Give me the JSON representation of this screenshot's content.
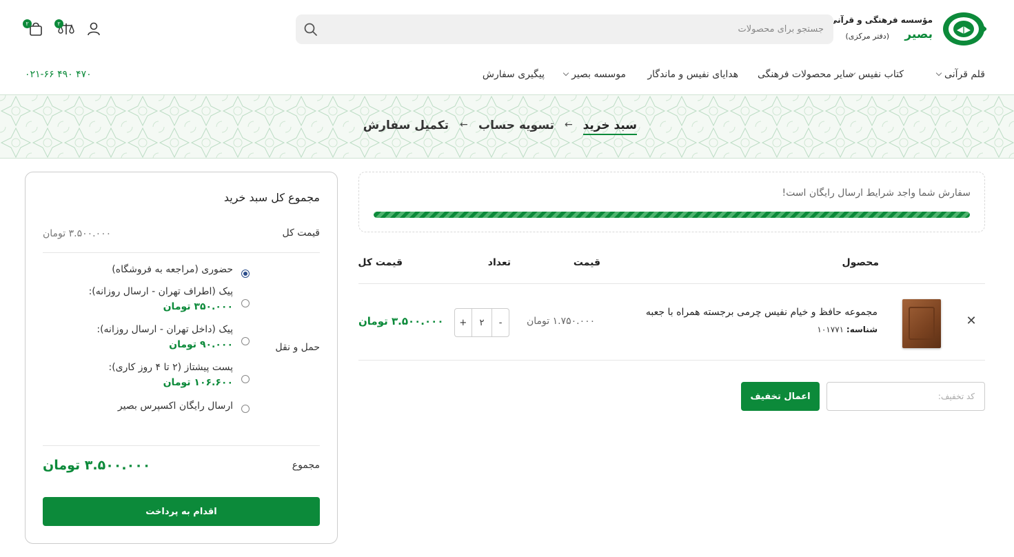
{
  "header": {
    "logo_line1": "مؤسسه فرهنگی و قرآنی",
    "logo_line2": "بصیر",
    "logo_line3": "(دفتر مرکزی)",
    "search_placeholder": "جستجو برای محصولات",
    "compare_count": "۲",
    "cart_count": "۲",
    "brand_color": "#0c8a3a"
  },
  "nav": {
    "items": [
      {
        "label": "قلم قرآنی",
        "has_dropdown": true
      },
      {
        "label": "کتاب نفیس",
        "has_dropdown": true
      },
      {
        "label": "سایر محصولات فرهنگی",
        "has_dropdown": false
      },
      {
        "label": "هدایای نفیس و ماندگار",
        "has_dropdown": false
      },
      {
        "label": "موسسه بصیر",
        "has_dropdown": true
      },
      {
        "label": "پیگیری سفارش",
        "has_dropdown": false
      }
    ],
    "phone": "۰۲۱-۶۶ ۴۹۰ ۴۷۰"
  },
  "steps": [
    "سبد خرید",
    "تسویه حساب",
    "تکمیل سفارش"
  ],
  "free_shipping": {
    "message": "سفارش شما واجد شرایط ارسال رایگان است!",
    "progress": 1.0
  },
  "cart_table": {
    "headers": {
      "product": "محصول",
      "price": "قیمت",
      "quantity": "تعداد",
      "subtotal": "قیمت کل"
    },
    "rows": [
      {
        "name": "مجموعه حافظ و خیام نفیس چرمی برجسته همراه با جعبه",
        "sku_label": "شناسه:",
        "sku": "۱۰۱۷۷۱",
        "price": "۱.۷۵۰.۰۰۰ تومان",
        "quantity": "۲",
        "subtotal": "۳.۵۰۰.۰۰۰ تومان"
      }
    ]
  },
  "coupon": {
    "placeholder": "کد تخفیف:",
    "button": "اعمال تخفیف"
  },
  "totals": {
    "title": "مجموع کل سبد خرید",
    "subtotal_label": "قیمت کل",
    "subtotal_value": "۳.۵۰۰.۰۰۰ تومان",
    "shipping_label": "حمل و نقل",
    "shipping_options": [
      {
        "label": "حضوری (مراجعه به فروشگاه)",
        "price": "",
        "selected": true
      },
      {
        "label": "پیک (اطراف تهران - ارسال روزانه):",
        "price": "۳۵۰.۰۰۰ تومان",
        "selected": false
      },
      {
        "label": "پیک (داخل تهران - ارسال روزانه):",
        "price": "۹۰.۰۰۰ تومان",
        "selected": false
      },
      {
        "label": "پست پیشتاز (۲ تا ۴ روز کاری):",
        "price": "۱۰۶.۶۰۰ تومان",
        "selected": false
      },
      {
        "label": "ارسال رایگان اکسپرس بصیر",
        "price": "",
        "selected": false
      }
    ],
    "total_label": "مجموع",
    "total_value": "۳.۵۰۰.۰۰۰ تومان",
    "checkout_button": "اقدام به پرداخت"
  }
}
